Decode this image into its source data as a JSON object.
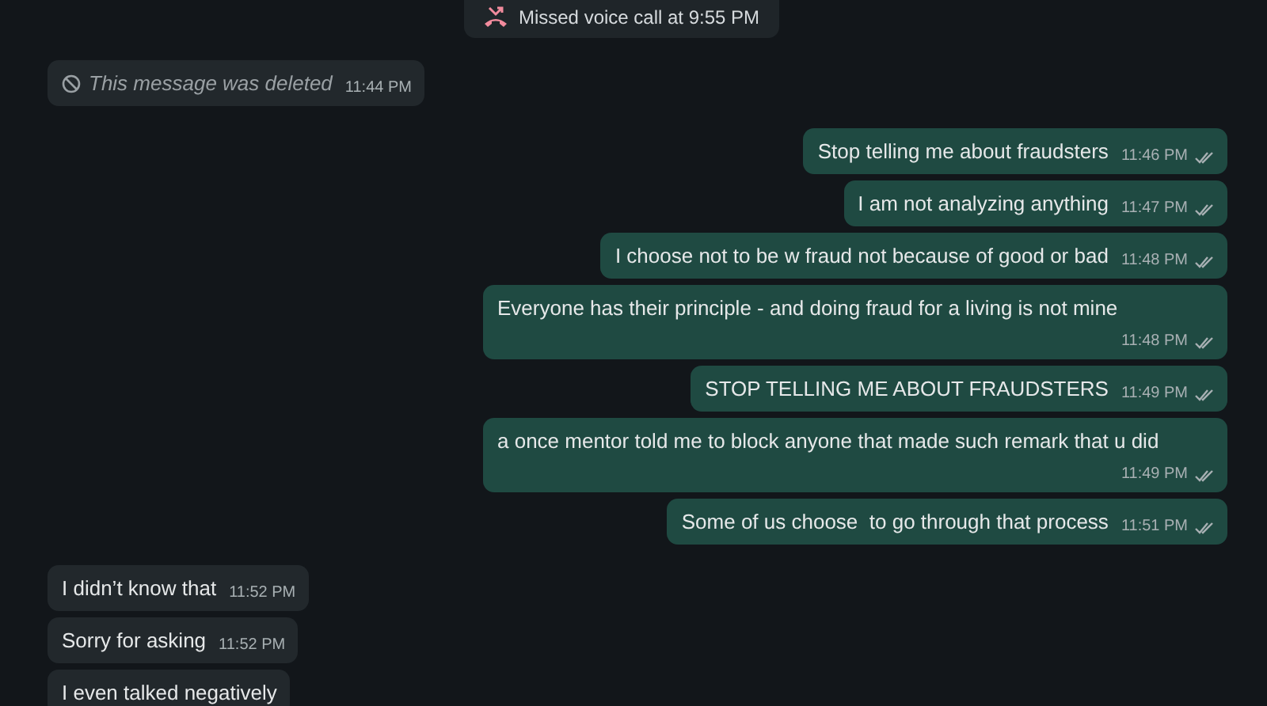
{
  "notice": {
    "text": "Missed voice call at 9:55 PM"
  },
  "messages": [
    {
      "kind": "deleted",
      "sent": false,
      "text": "This message was deleted",
      "time": "11:44 PM"
    },
    {
      "kind": "text",
      "sent": true,
      "text": "Stop telling me about fraudsters",
      "time": "11:46 PM",
      "read": false
    },
    {
      "kind": "text",
      "sent": true,
      "text": "I am not analyzing anything",
      "time": "11:47 PM",
      "read": false
    },
    {
      "kind": "text",
      "sent": true,
      "text": "I choose not to be w fraud not because of good or bad",
      "time": "11:48 PM",
      "read": false
    },
    {
      "kind": "text",
      "sent": true,
      "text": "Everyone has their principle - and doing fraud for a living is not mine",
      "time": "11:48 PM",
      "read": false
    },
    {
      "kind": "text",
      "sent": true,
      "text": "STOP TELLING ME ABOUT FRAUDSTERS",
      "time": "11:49 PM",
      "read": false
    },
    {
      "kind": "text",
      "sent": true,
      "text": "a once mentor told me to block anyone that made such remark that u did",
      "time": "11:49 PM",
      "read": false
    },
    {
      "kind": "text",
      "sent": true,
      "text": "Some of us choose  to go through that process",
      "time": "11:51 PM",
      "read": false
    },
    {
      "kind": "text",
      "sent": false,
      "text": "I didn’t know that",
      "time": "11:52 PM"
    },
    {
      "kind": "text",
      "sent": false,
      "text": "Sorry for asking",
      "time": "11:52 PM"
    },
    {
      "kind": "text",
      "sent": false,
      "text": "I even talked negatively"
    }
  ]
}
